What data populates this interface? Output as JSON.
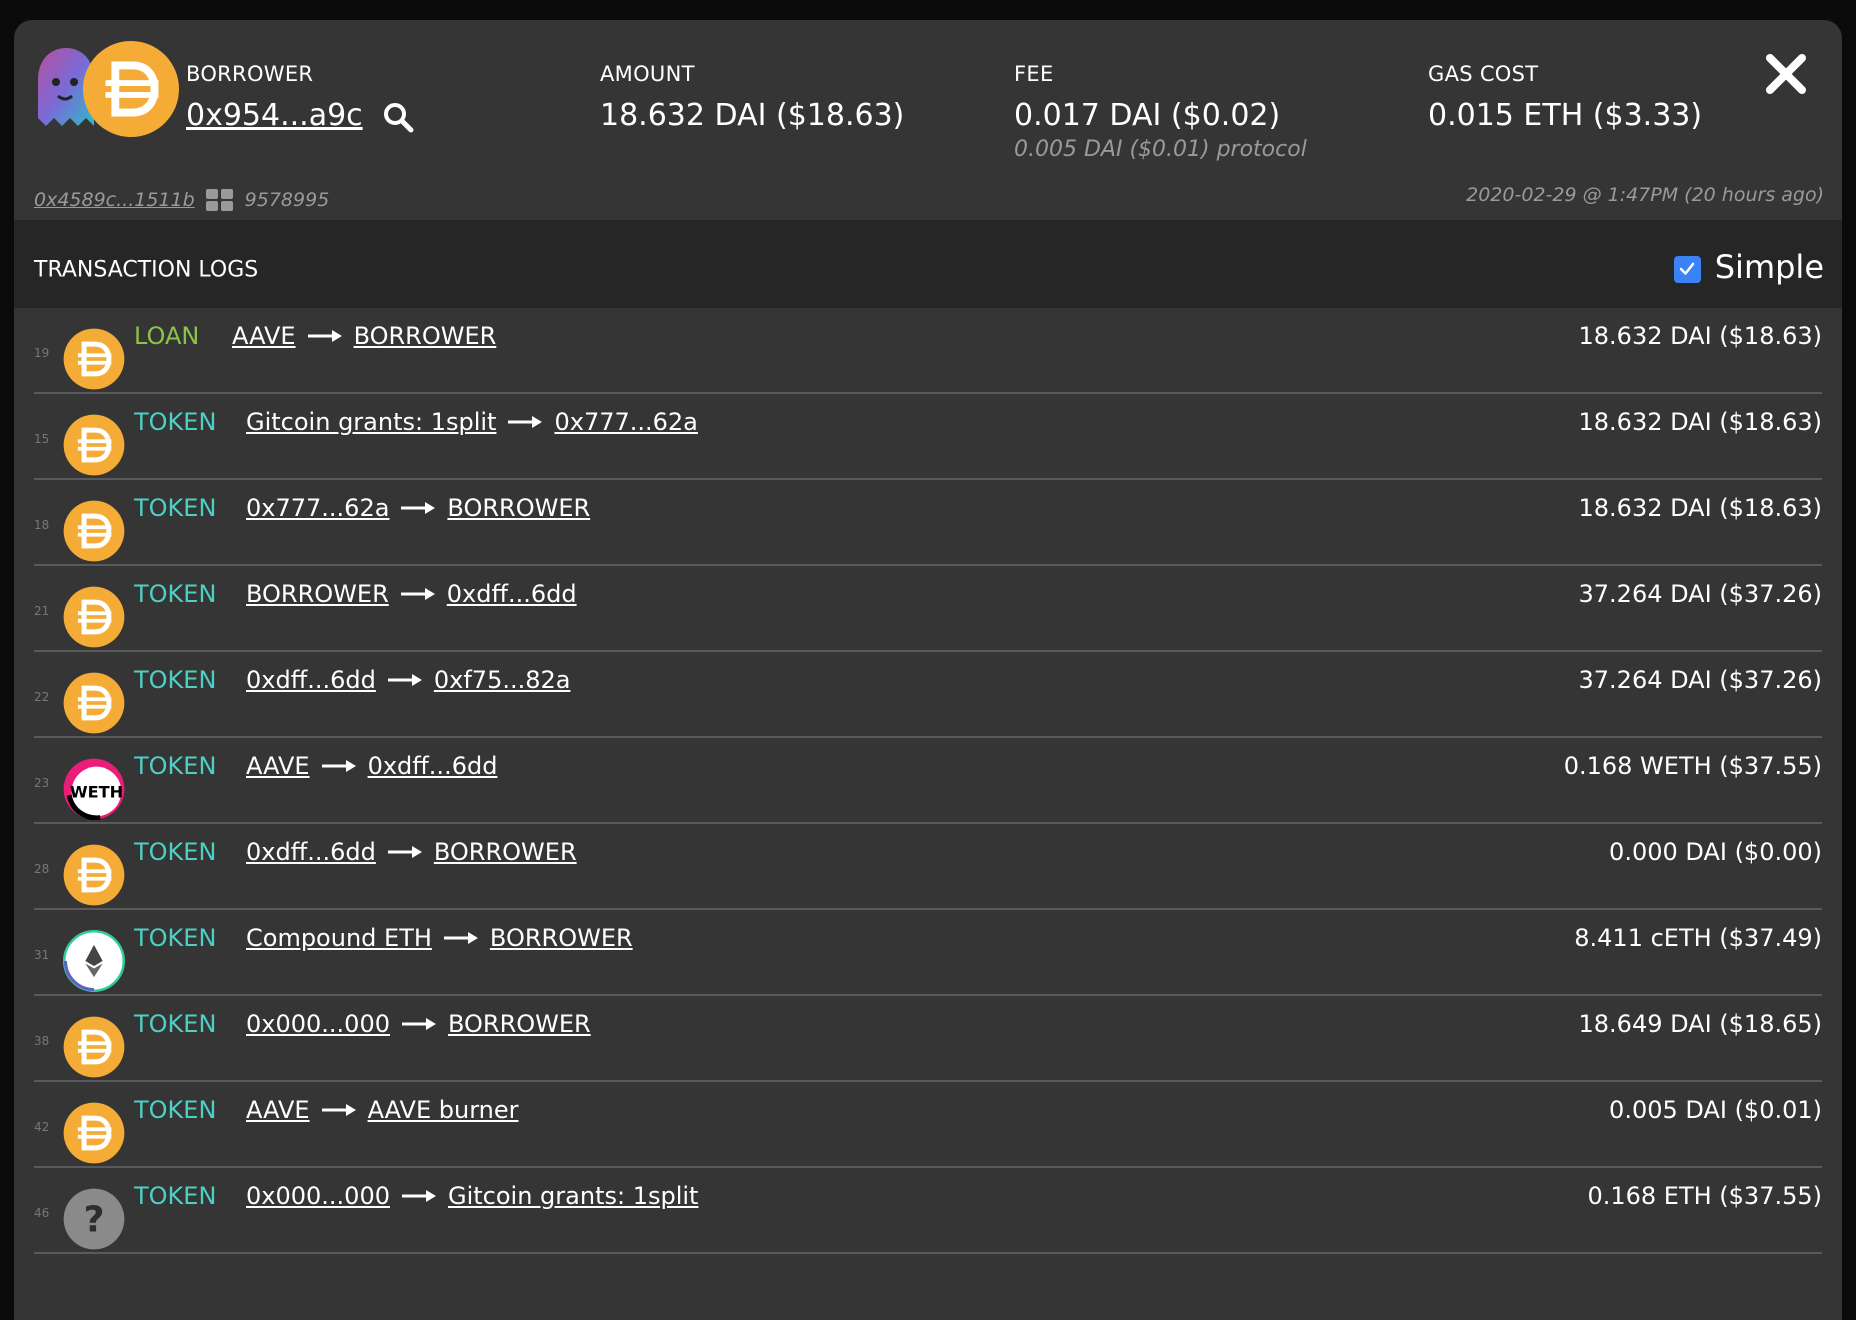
{
  "header": {
    "borrower_label": "BORROWER",
    "borrower_value": "0x954...a9c",
    "amount_label": "AMOUNT",
    "amount_value": "18.632 DAI  ($18.63)",
    "fee_label": "FEE",
    "fee_value": "0.017 DAI  ($0.02)",
    "fee_sub": "0.005 DAI  ($0.01) protocol",
    "gas_label": "GAS COST",
    "gas_value": "0.015 ETH  ($3.33)",
    "tx_hash": "0x4589c...1511b",
    "block": "9578995",
    "timestamp": "2020-02-29 @ 1:47PM (20 hours ago)"
  },
  "logs": {
    "title": "TRANSACTION LOGS",
    "simple_label": "Simple",
    "simple_checked": true
  },
  "colors": {
    "loan": "#8bc34a",
    "token": "#4dd0c4",
    "dai": "#f5ac37",
    "checkbox": "#3b82f6"
  },
  "rows": [
    {
      "idx": "19",
      "icon": "dai-icon",
      "kind": "LOAN",
      "from": "AAVE",
      "to": "BORROWER",
      "amount": "18.632 DAI  ($18.63)"
    },
    {
      "idx": "15",
      "icon": "dai-icon",
      "kind": "TOKEN",
      "from": "Gitcoin grants: 1split",
      "to": "0x777...62a",
      "amount": "18.632 DAI  ($18.63)"
    },
    {
      "idx": "18",
      "icon": "dai-icon",
      "kind": "TOKEN",
      "from": "0x777...62a",
      "to": "BORROWER",
      "amount": "18.632 DAI  ($18.63)"
    },
    {
      "idx": "21",
      "icon": "dai-icon",
      "kind": "TOKEN",
      "from": "BORROWER",
      "to": "0xdff...6dd",
      "amount": "37.264 DAI  ($37.26)"
    },
    {
      "idx": "22",
      "icon": "dai-icon",
      "kind": "TOKEN",
      "from": "0xdff...6dd",
      "to": "0xf75...82a",
      "amount": "37.264 DAI  ($37.26)"
    },
    {
      "idx": "23",
      "icon": "weth-icon",
      "kind": "TOKEN",
      "from": "AAVE",
      "to": "0xdff...6dd",
      "amount": "0.168 WETH  ($37.55)"
    },
    {
      "idx": "28",
      "icon": "dai-icon",
      "kind": "TOKEN",
      "from": "0xdff...6dd",
      "to": "BORROWER",
      "amount": "0.000 DAI  ($0.00)"
    },
    {
      "idx": "31",
      "icon": "ceth-icon",
      "kind": "TOKEN",
      "from": "Compound ETH",
      "to": "BORROWER",
      "amount": "8.411 cETH  ($37.49)"
    },
    {
      "idx": "38",
      "icon": "dai-icon",
      "kind": "TOKEN",
      "from": "0x000...000",
      "to": "BORROWER",
      "amount": "18.649 DAI  ($18.65)"
    },
    {
      "idx": "42",
      "icon": "dai-icon",
      "kind": "TOKEN",
      "from": "AAVE",
      "to": "AAVE burner",
      "amount": "0.005 DAI  ($0.01)"
    },
    {
      "idx": "46",
      "icon": "unknown-token-icon",
      "kind": "TOKEN",
      "from": "0x000...000",
      "to": "Gitcoin grants: 1split",
      "amount": "0.168 ETH  ($37.55)"
    }
  ]
}
